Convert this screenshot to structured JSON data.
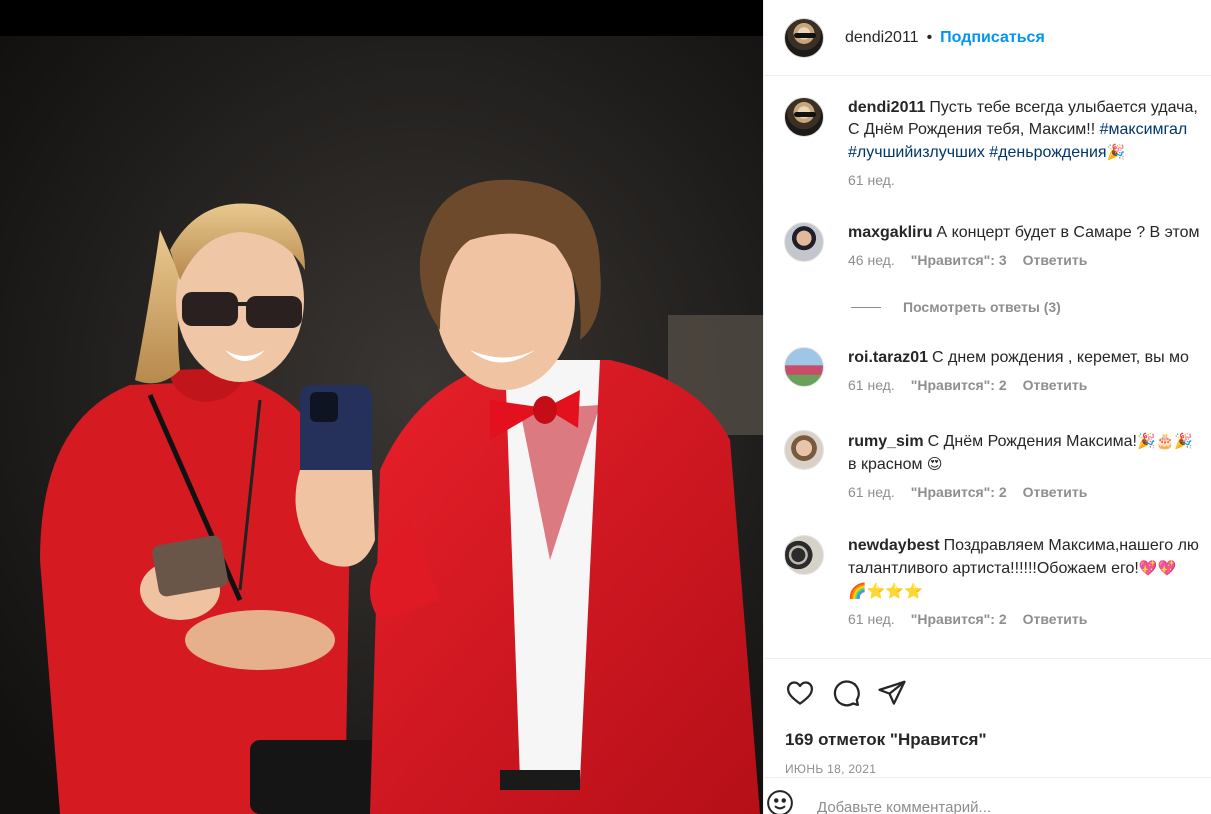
{
  "post": {
    "author": "dendi2011",
    "separator": "•",
    "follow_label": "Подписаться"
  },
  "comments": [
    {
      "username": "dendi2011",
      "line1": "Пусть тебе всегда улыбается удача,",
      "line2": "С Днём Рождения тебя, Максим!! ",
      "line2_tag": "#максимгал",
      "line3_tags": "#лучшийизлучших #деньрождения",
      "line3_emoji": "🎉",
      "time": "61 нед."
    },
    {
      "username": "maxgakliru",
      "text": "А концерт будет в Самаре ? В этом",
      "time": "46 нед.",
      "likes": "\"Нравится\": 3",
      "reply": "Ответить"
    },
    {
      "username": "roi.taraz01",
      "text": "С днем рождения , керемет, вы мо",
      "time": "61 нед.",
      "likes": "\"Нравится\": 2",
      "reply": "Ответить"
    },
    {
      "username": "rumy_sim",
      "text": "С Днём Рождения Максима!",
      "text_emoji": "🎉🎂🎉",
      "line2": "в красном ",
      "line2_emoji": "😍",
      "time": "61 нед.",
      "likes": "\"Нравится\": 2",
      "reply": "Ответить"
    },
    {
      "username": "newdaybest",
      "text": "Поздравляем Максима,нашего лю",
      "line2": "талантливого артиста!!!!!!Обожаем его!",
      "line2_emoji": "💖💖",
      "line3_emoji": "🌈⭐⭐⭐",
      "time": "61 нед.",
      "likes": "\"Нравится\": 2",
      "reply": "Ответить"
    }
  ],
  "view_replies": "Посмотреть ответы (3)",
  "actions": {
    "like_icon": "heart-icon",
    "comment_icon": "comment-icon",
    "share_icon": "share-icon"
  },
  "likes_count": "169 отметок \"Нравится\"",
  "date": "ИЮНЬ 18, 2021",
  "comment_placeholder": "Добавьте комментарий...",
  "colors": {
    "link_blue": "#0095f6",
    "hashtag": "#00376b",
    "meta_gray": "#8e8e8e",
    "jacket_red": "#d8141f"
  }
}
